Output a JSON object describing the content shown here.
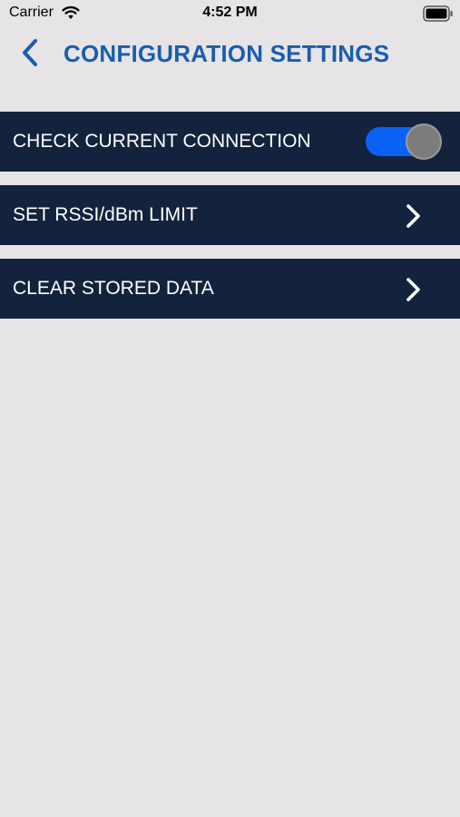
{
  "status_bar": {
    "carrier": "Carrier",
    "time": "4:52 PM",
    "icons": [
      "wifi-icon",
      "battery-icon"
    ]
  },
  "nav": {
    "back_icon": "chevron-left-icon",
    "title": "CONFIGURATION SETTINGS",
    "title_color": "#1a5dad"
  },
  "settings": {
    "row_color": "#13223d",
    "items": [
      {
        "label": "CHECK CURRENT CONNECTION",
        "control": "toggle",
        "on": true,
        "toggle_color": "#0a62f5"
      },
      {
        "label": "SET RSSI/dBm LIMIT",
        "control": "chevron-right-icon"
      },
      {
        "label": "CLEAR STORED DATA",
        "control": "chevron-right-icon"
      }
    ]
  },
  "background_color": "#e6e4e6"
}
